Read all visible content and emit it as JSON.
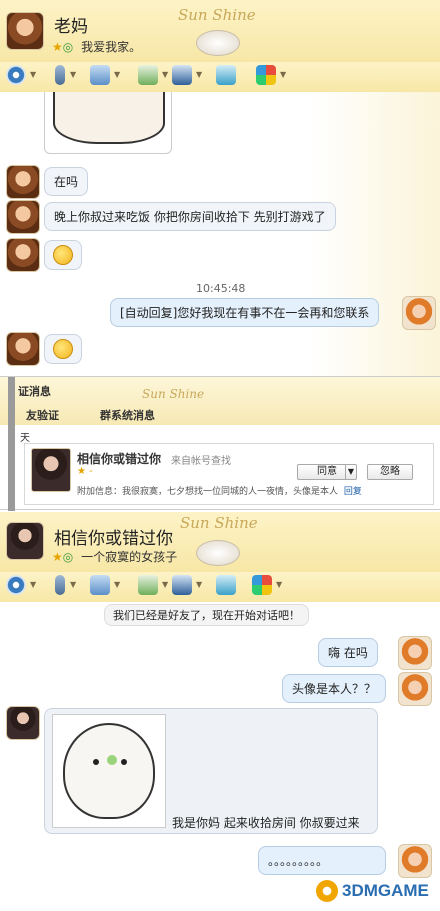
{
  "chat1": {
    "contact_name": "老妈",
    "signature": "我爱我家。",
    "messages": [
      {
        "text": "在吗"
      },
      {
        "text": "晚上你叔过来吃饭 你把你房间收拾下 先别打游戏了"
      }
    ],
    "timestamp": "10:45:48",
    "auto_reply": "[自动回复]您好我现在有事不在一会再和您联系"
  },
  "sun_logo": "Sun Shine",
  "dialog": {
    "title": "证消息",
    "tab_friend_verify": "友验证",
    "tab_system": "群系统消息",
    "tab_short": "天",
    "requester_name": "相信你或错过你",
    "source": "来自帐号查找",
    "stars": "★ - ",
    "note": "附加信息：我很寂寞，七夕想找一位同城的人一夜情，头像是本人",
    "reply_link": "回复",
    "agree_label": "同意",
    "ignore_label": "忽略"
  },
  "chat2": {
    "contact_name": "相信你或错过你",
    "signature": "一个寂寞的女孩子",
    "system_msg": "我们已经是好友了，现在开始对话吧！",
    "messages": [
      {
        "text": "嗨 在吗"
      },
      {
        "text": "头像是本人？？"
      },
      {
        "text": "我是你妈 起来收拾房间 你叔要过来"
      },
      {
        "text": "。。。。。。。。。"
      }
    ]
  },
  "watermark": "3DMGAME",
  "icons": [
    "camera-icon",
    "mic-icon",
    "folder-icon",
    "transfer-icon",
    "screen-icon",
    "share-icon",
    "apps-icon",
    "emoji-icon"
  ]
}
